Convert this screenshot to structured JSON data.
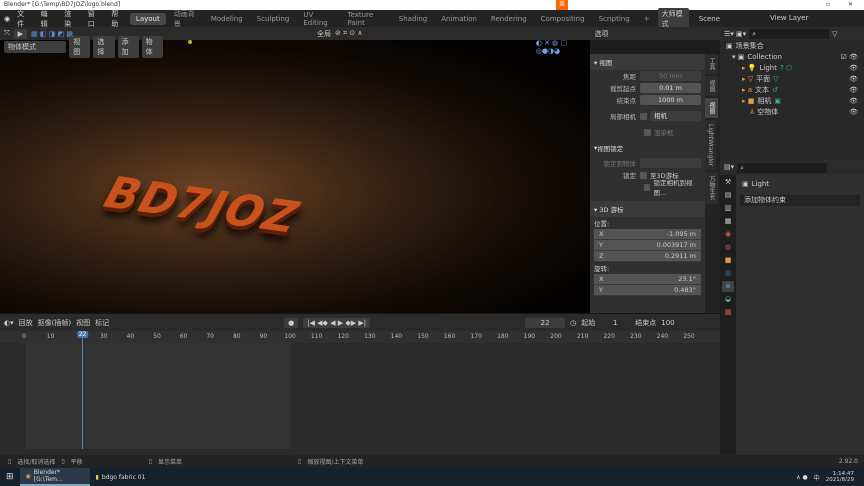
{
  "title": "Blender* [G:\\Temp\\BD7JOZ\\logo.blend]",
  "ime_label": "英",
  "menu": [
    "文件",
    "编辑",
    "渲染",
    "窗口",
    "帮助"
  ],
  "workspaces": [
    "Layout",
    "动画背景",
    "Modeling",
    "Sculpting",
    "UV Editing",
    "Texture Paint",
    "Shading",
    "Animation",
    "Rendering",
    "Compositing",
    "Scripting"
  ],
  "add_tab": "+",
  "mode_button": "大师模式",
  "scene": "Scene",
  "view_layer": "View Layer",
  "header": {
    "orientation": "全局",
    "options": "选项"
  },
  "viewport": {
    "mode": "物体模式",
    "menus": [
      "视图",
      "选择",
      "添加",
      "物体"
    ],
    "logo_text": "BD7JOZ"
  },
  "npanel": {
    "tabs": [
      "工具",
      "视图",
      "视图",
      "LightWrangler",
      "万物生长"
    ],
    "view_title": "视图",
    "focal_label": "焦距",
    "focal": "50 mm",
    "clip_start_label": "裁剪起点",
    "clip_start": "0.01 m",
    "clip_end_label": "结束点",
    "clip_end": "1000 m",
    "local_camera_label": "局部相机",
    "camera": "相机",
    "render_region": "渲染框",
    "lock_title": "视图锁定",
    "lock_object_label": "锁定到物体",
    "lock_label": "锁定",
    "lock_3d_cursor": "至3D游标",
    "lock_camera": "锁定相机到视图...",
    "cursor_title": "3D 游标",
    "location_label": "位置:",
    "loc": [
      [
        "X",
        "-1.095 m"
      ],
      [
        "Y",
        "0.003917 m"
      ],
      [
        "Z",
        "0.2911 m"
      ]
    ],
    "rotation_label": "旋转:",
    "rot": [
      [
        "X",
        "23.1°"
      ],
      [
        "Y",
        "0.483°"
      ]
    ]
  },
  "outliner": {
    "root": "场景集合",
    "collection": "Collection",
    "items": [
      "Light",
      "平面",
      "文本",
      "相机",
      "空物体"
    ]
  },
  "properties": {
    "object": "Light",
    "add_constraint": "添加物体约束"
  },
  "timeline": {
    "menus": [
      "回放",
      "抠像(插帧)",
      "视图",
      "标记"
    ],
    "current_frame": "22",
    "start_label": "起始",
    "start": "1",
    "end_label": "结束点",
    "end": "100",
    "ticks": [
      "0",
      "10",
      "22",
      "30",
      "40",
      "50",
      "60",
      "70",
      "80",
      "90",
      "100",
      "110",
      "120",
      "130",
      "140",
      "150",
      "160",
      "170",
      "180",
      "190",
      "200",
      "210",
      "220",
      "230",
      "240",
      "250"
    ]
  },
  "status": {
    "items": [
      "选择/取消选择",
      "平移",
      "显示菜单",
      "缩放视图/上下文菜单"
    ],
    "version": "2.92.0"
  },
  "taskbar": {
    "apps": [
      "Blender* [G:\\Tem...",
      "bdgo fabric 01"
    ],
    "time": "1:14:47",
    "date": "2021/8/29",
    "lang": "中"
  }
}
